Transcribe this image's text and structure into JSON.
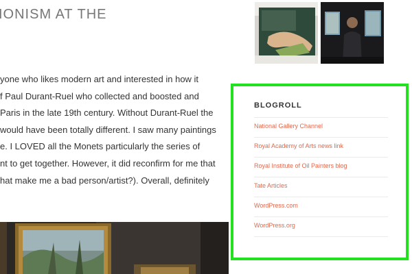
{
  "post": {
    "title": "IONISM AT THE",
    "lines": [
      "yone who likes modern art and interested in how it",
      "f Paul Durant-Ruel who collected and boosted and",
      "Paris in the late 19th century. Without Durant-Ruel the",
      " would have been totally different. I saw many paintings",
      "e. I LOVED all the Monets particularly the series of",
      "nt to get together. However, it did reconfirm for me that",
      "hat make me a bad person/artist?). Overall, definitely"
    ]
  },
  "blogroll": {
    "heading": "BLOGROLL",
    "links": [
      "National Gallery Channel",
      "Royal Academy of Arts news link",
      "Royal Institute of Oil Painters blog",
      "Tate Articles",
      "WordPress.com",
      "WordPress.org"
    ]
  },
  "colors": {
    "link": "#e2674b",
    "highlight": "#22e11f",
    "title": "#777777"
  }
}
